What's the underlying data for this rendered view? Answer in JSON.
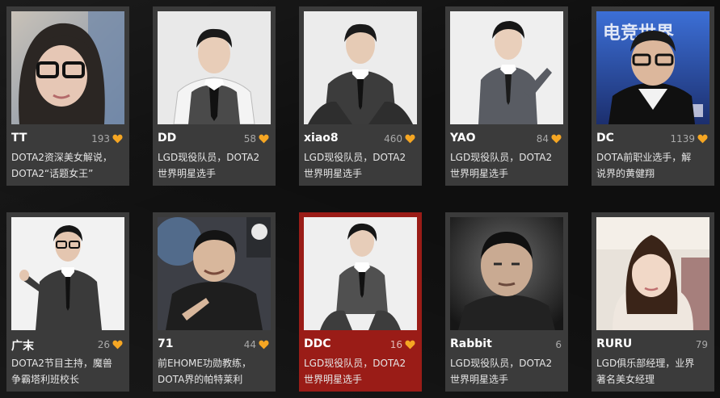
{
  "colors": {
    "card_bg": "#3b3b3b",
    "card_active_bg": "#9a1c17",
    "heart": "#f5a623",
    "page_bg": "#0f0f0f"
  },
  "cards": [
    {
      "name": "TT",
      "likes": "193",
      "heart": true,
      "desc1": "DOTA2资深美女解说，",
      "desc2": "DOTA2“话题女王”"
    },
    {
      "name": "DD",
      "likes": "58",
      "heart": true,
      "desc1": "LGD现役队员，DOTA2",
      "desc2": "世界明星选手"
    },
    {
      "name": "xiao8",
      "likes": "460",
      "heart": true,
      "desc1": "LGD现役队员，DOTA2",
      "desc2": "世界明星选手"
    },
    {
      "name": "YAO",
      "likes": "84",
      "heart": true,
      "desc1": "LGD现役队员，DOTA2",
      "desc2": "世界明星选手"
    },
    {
      "name": "DC",
      "likes": "1139",
      "heart": true,
      "desc1": "DOTA前职业选手，解",
      "desc2": "说界的黄健翔",
      "photo_text": "电竞世界"
    },
    {
      "name": "广末",
      "likes": "26",
      "heart": true,
      "desc1": "DOTA2节目主持，魔兽",
      "desc2": "争霸塔利班校长"
    },
    {
      "name": "71",
      "likes": "44",
      "heart": true,
      "desc1": "前EHOME功勋教练，",
      "desc2": "DOTA界的帕特莱利"
    },
    {
      "name": "DDC",
      "likes": "16",
      "heart": true,
      "desc1": "LGD现役队员，DOTA2",
      "desc2": "世界明星选手"
    },
    {
      "name": "Rabbit",
      "likes": "6",
      "heart": false,
      "desc1": "LGD现役队员，DOTA2",
      "desc2": "世界明星选手"
    },
    {
      "name": "RURU",
      "likes": "79",
      "heart": false,
      "desc1": "LGD俱乐部经理，业界",
      "desc2": "著名美女经理"
    }
  ]
}
